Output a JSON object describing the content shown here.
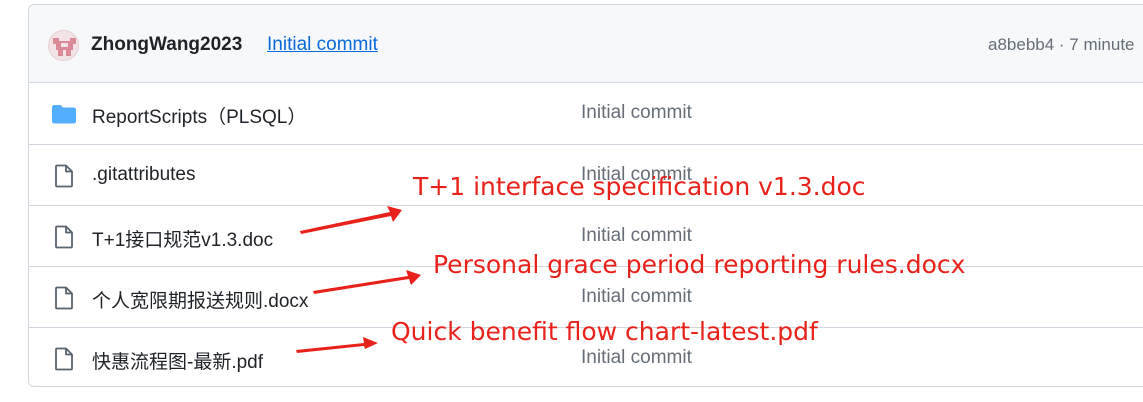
{
  "commit": {
    "author": "ZhongWang2023",
    "message": "Initial commit",
    "meta": "a8bebb4 · 7 minute"
  },
  "files": [
    {
      "name": "ReportScripts（PLSQL）",
      "type": "folder",
      "icon": "folder-icon",
      "message": "Initial commit"
    },
    {
      "name": ".gitattributes",
      "type": "file",
      "icon": "file-icon",
      "message": "Initial commit"
    },
    {
      "name": "T+1接口规范v1.3.doc",
      "type": "file",
      "icon": "file-icon",
      "message": "Initial commit"
    },
    {
      "name": "个人宽限期报送规则.docx",
      "type": "file",
      "icon": "file-icon",
      "message": "Initial commit"
    },
    {
      "name": "快惠流程图-最新.pdf",
      "type": "file",
      "icon": "file-icon",
      "message": "Initial commit"
    }
  ],
  "annotations": [
    {
      "text": "T+1 interface specification v1.3.doc",
      "color": "#e8211b"
    },
    {
      "text": "Personal grace period reporting rules.docx",
      "color": "#e8211b"
    },
    {
      "text": "Quick benefit flow chart-latest.pdf",
      "color": "#e8211b"
    }
  ],
  "colors": {
    "link": "#0969da",
    "muted": "#656d76",
    "border": "#d0d7de",
    "folder": "#54aeff",
    "annotation": "#e8211b"
  }
}
